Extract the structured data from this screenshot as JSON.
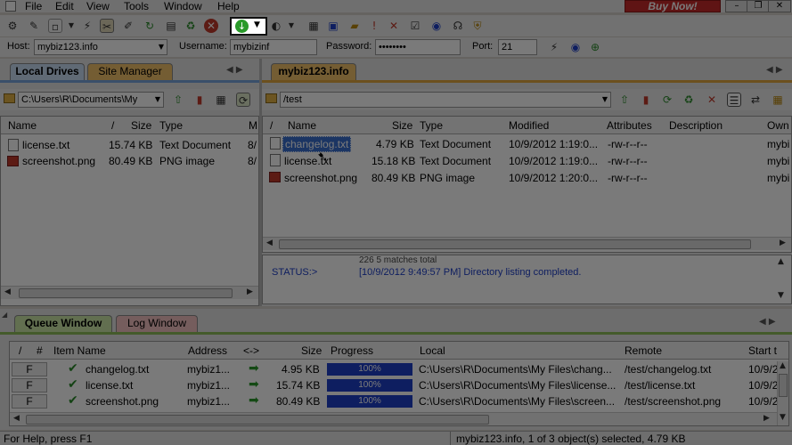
{
  "menu": {
    "file": "File",
    "edit": "Edit",
    "view": "View",
    "tools": "Tools",
    "window": "Window",
    "help": "Help",
    "buy_now": "Buy Now!"
  },
  "connection": {
    "host_label": "Host:",
    "host": "mybiz123.info",
    "user_label": "Username:",
    "user": "mybizinf",
    "pass_label": "Password:",
    "pass": "••••••••",
    "port_label": "Port:",
    "port": "21"
  },
  "left": {
    "tabs": [
      "Local Drives",
      "Site Manager"
    ],
    "path": "C:\\Users\\R\\Documents\\My",
    "cols": [
      "Name",
      "/",
      "Size",
      "Type",
      "M"
    ],
    "rows": [
      {
        "name": "license.txt",
        "size": "15.74 KB",
        "type": "Text Document",
        "mod": "8/"
      },
      {
        "name": "screenshot.png",
        "size": "80.49 KB",
        "type": "PNG image",
        "mod": "8/"
      }
    ]
  },
  "right": {
    "tab": "mybiz123.info",
    "path": "/test",
    "cols": [
      "/",
      "Name",
      "Size",
      "Type",
      "Modified",
      "Attributes",
      "Description",
      "Own"
    ],
    "rows": [
      {
        "name": "changelog.txt",
        "size": "4.79 KB",
        "type": "Text Document",
        "mod": "10/9/2012 1:19:0...",
        "attr": "-rw-r--r--",
        "owner": "mybi"
      },
      {
        "name": "license.txt",
        "size": "15.18 KB",
        "type": "Text Document",
        "mod": "10/9/2012 1:19:0...",
        "attr": "-rw-r--r--",
        "owner": "mybi"
      },
      {
        "name": "screenshot.png",
        "size": "80.49 KB",
        "type": "PNG image",
        "mod": "10/9/2012 1:20:0...",
        "attr": "-rw-r--r--",
        "owner": "mybi"
      }
    ],
    "log_top": "226 5 matches total",
    "status_label": "STATUS:>",
    "status_msg": "[10/9/2012 9:49:57 PM] Directory listing completed."
  },
  "queue": {
    "tabs": [
      "Queue Window",
      "Log Window"
    ],
    "cols": [
      "/",
      "#",
      "Item Name",
      "Address",
      "<->",
      "Size",
      "Progress",
      "Local",
      "Remote",
      "Start t"
    ],
    "rows": [
      {
        "f": "F",
        "name": "changelog.txt",
        "addr": "mybiz1...",
        "size": "4.95 KB",
        "progress": "100%",
        "local": "C:\\Users\\R\\Documents\\My Files\\chang...",
        "remote": "/test/changelog.txt",
        "start": "10/9/2"
      },
      {
        "f": "F",
        "name": "license.txt",
        "addr": "mybiz1...",
        "size": "15.74 KB",
        "progress": "100%",
        "local": "C:\\Users\\R\\Documents\\My Files\\license...",
        "remote": "/test/license.txt",
        "start": "10/9/2"
      },
      {
        "f": "F",
        "name": "screenshot.png",
        "addr": "mybiz1...",
        "size": "80.49 KB",
        "progress": "100%",
        "local": "C:\\Users\\R\\Documents\\My Files\\screen...",
        "remote": "/test/screenshot.png",
        "start": "10/9/2"
      }
    ]
  },
  "status": {
    "left": "For Help, press F1",
    "right": "mybiz123.info, 1 of 3 object(s) selected, 4.79 KB"
  },
  "colors": {
    "accent": "#1e3fc8",
    "tab_orange": "#f3c26b",
    "tab_blue": "#c9ddf5",
    "tab_green": "#cde8a8",
    "tab_red": "#f5c3c3",
    "highlight": "#ffffff"
  }
}
